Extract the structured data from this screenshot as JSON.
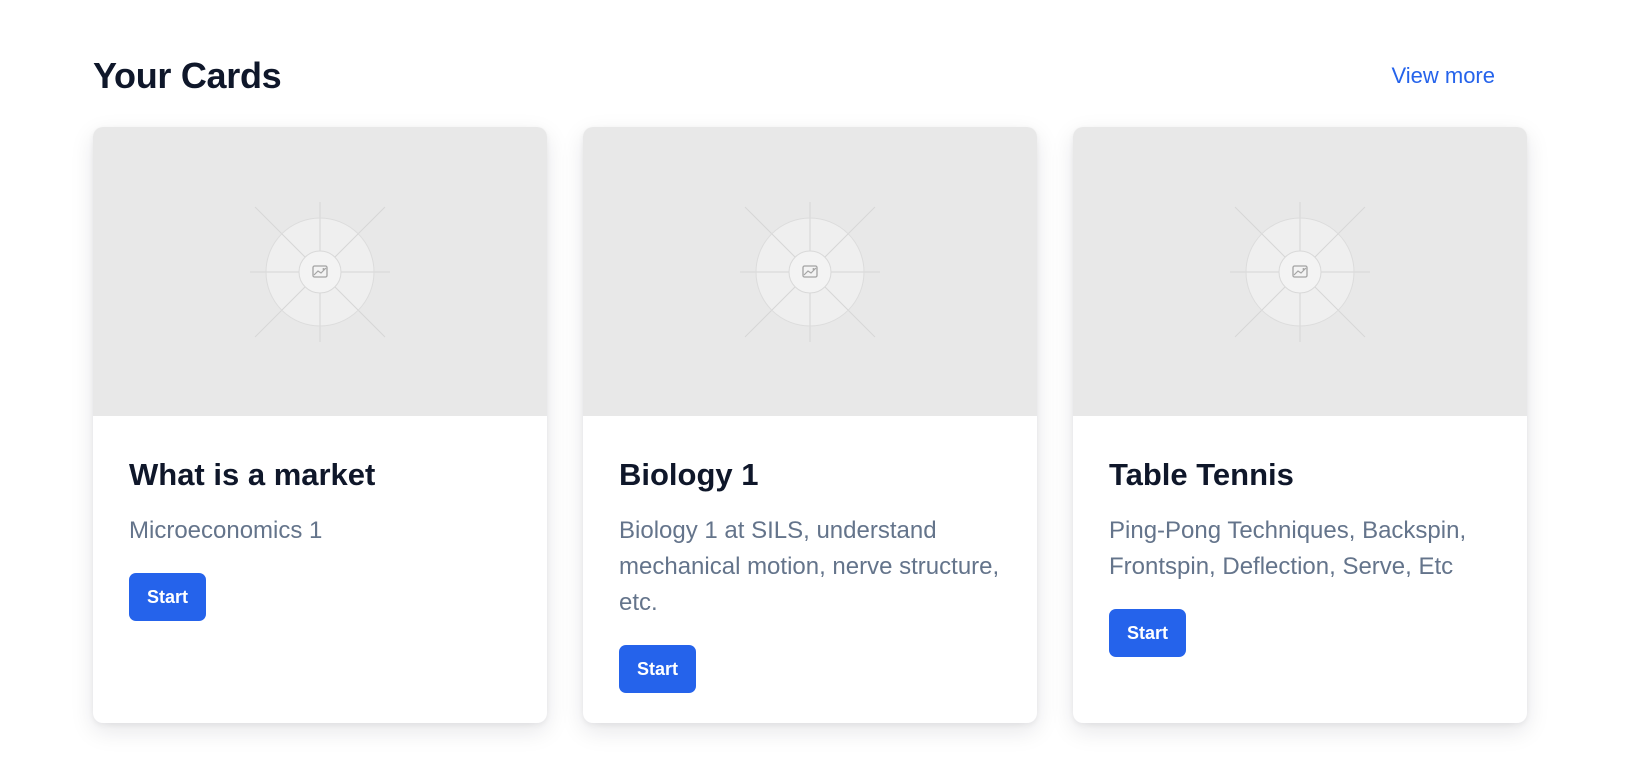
{
  "header": {
    "title": "Your Cards",
    "view_more_label": "View more"
  },
  "cards": [
    {
      "title": "What is a market",
      "description": "Microeconomics 1",
      "button_label": "Start",
      "image_icon": "image-placeholder-icon"
    },
    {
      "title": "Biology 1",
      "description": "Biology 1 at SILS, understand mechanical motion, nerve structure, etc.",
      "button_label": "Start",
      "image_icon": "image-placeholder-icon"
    },
    {
      "title": "Table Tennis",
      "description": "Ping-Pong Techniques, Backspin, Frontspin, Deflection, Serve, Etc",
      "button_label": "Start",
      "image_icon": "image-placeholder-icon"
    }
  ],
  "colors": {
    "accent": "#2563eb",
    "title": "#0f172a",
    "muted_text": "#64748b",
    "placeholder_bg": "#e8e8e8"
  }
}
